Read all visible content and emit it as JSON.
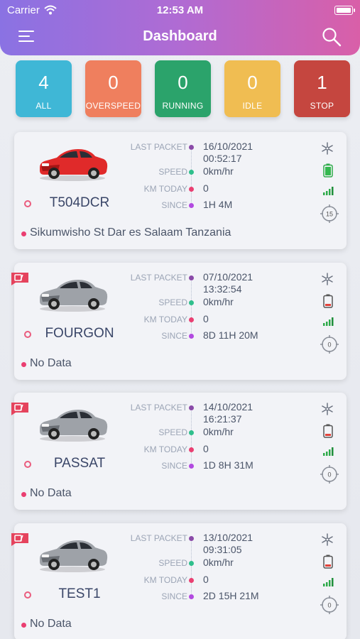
{
  "status_bar": {
    "carrier": "Carrier",
    "time": "12:53 AM"
  },
  "header": {
    "title": "Dashboard"
  },
  "stats": [
    {
      "count": "4",
      "label": "ALL",
      "color": "#3fb7d6"
    },
    {
      "count": "0",
      "label": "OVERSPEED",
      "color": "#ef7f5e"
    },
    {
      "count": "0",
      "label": "RUNNING",
      "color": "#2ba36b"
    },
    {
      "count": "0",
      "label": "IDLE",
      "color": "#f0bd52"
    },
    {
      "count": "1",
      "label": "STOP",
      "color": "#c5463f"
    }
  ],
  "labels": {
    "last_packet": "LAST PACKET",
    "speed": "SPEED",
    "km_today": "KM TODAY",
    "since": "SINCE"
  },
  "vehicles": [
    {
      "name": "T504DCR",
      "car_color": "red",
      "last_packet_date": "16/10/2021",
      "last_packet_time": "00:52:17",
      "speed": "0km/hr",
      "km_today": "0",
      "since": "1H 4M",
      "address": "Sikumwisho St Dar es Salaam Tanzania",
      "battery": "full",
      "gauge_value": "15",
      "alert": false
    },
    {
      "name": "FOURGON",
      "car_color": "gray",
      "last_packet_date": "07/10/2021",
      "last_packet_time": "13:32:54",
      "speed": "0km/hr",
      "km_today": "0",
      "since": "8D 11H 20M",
      "address": "No Data",
      "battery": "low",
      "gauge_value": "0",
      "alert": true
    },
    {
      "name": "PASSAT",
      "car_color": "gray",
      "last_packet_date": "14/10/2021",
      "last_packet_time": "16:21:37",
      "speed": "0km/hr",
      "km_today": "0",
      "since": "1D 8H 31M",
      "address": "No Data",
      "battery": "low",
      "gauge_value": "0",
      "alert": true
    },
    {
      "name": "TEST1",
      "car_color": "gray",
      "last_packet_date": "13/10/2021",
      "last_packet_time": "09:31:05",
      "speed": "0km/hr",
      "km_today": "0",
      "since": "2D 15H 21M",
      "address": "No Data",
      "battery": "low",
      "gauge_value": "0",
      "alert": true
    }
  ]
}
